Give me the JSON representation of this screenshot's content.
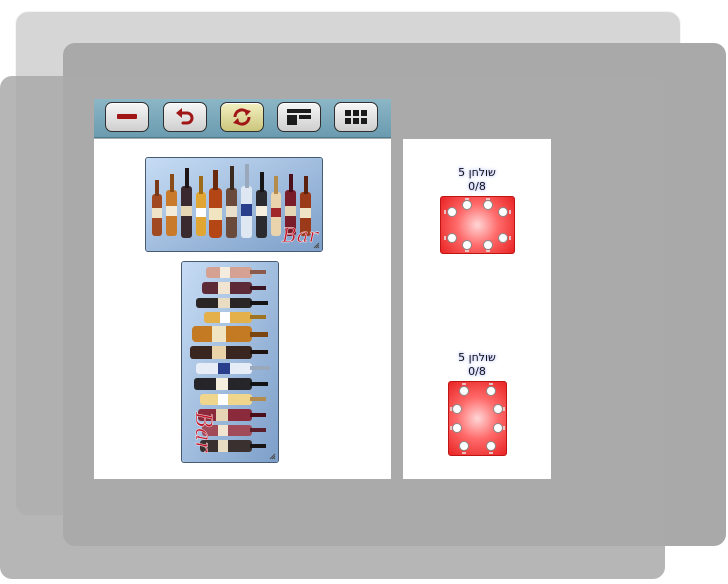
{
  "toolbar": {
    "buttons": [
      {
        "icon": "minus-icon",
        "color": "#a01616"
      },
      {
        "icon": "undo-arrow-icon",
        "color": "#a01616"
      },
      {
        "icon": "refresh-icon",
        "color": "#a01616"
      },
      {
        "icon": "layout-icon",
        "color": "#1a1a1a"
      },
      {
        "icon": "grid-icon",
        "color": "#1a1a1a"
      }
    ]
  },
  "left_panel": {
    "items": [
      {
        "label": "Bar"
      },
      {
        "label": "Bar"
      }
    ]
  },
  "right_panel": {
    "tables": [
      {
        "name": "שולחן 5",
        "occupancy": "0/8",
        "seats": 8,
        "orientation": "horizontal",
        "color": "#e82323"
      },
      {
        "name": "שולחן 5",
        "occupancy": "0/8",
        "seats": 8,
        "orientation": "vertical",
        "color": "#e82323"
      }
    ]
  },
  "colors": {
    "toolbar": "#7aa8bc",
    "table_red": "#e82323",
    "panel_bg": "#ffffff"
  }
}
